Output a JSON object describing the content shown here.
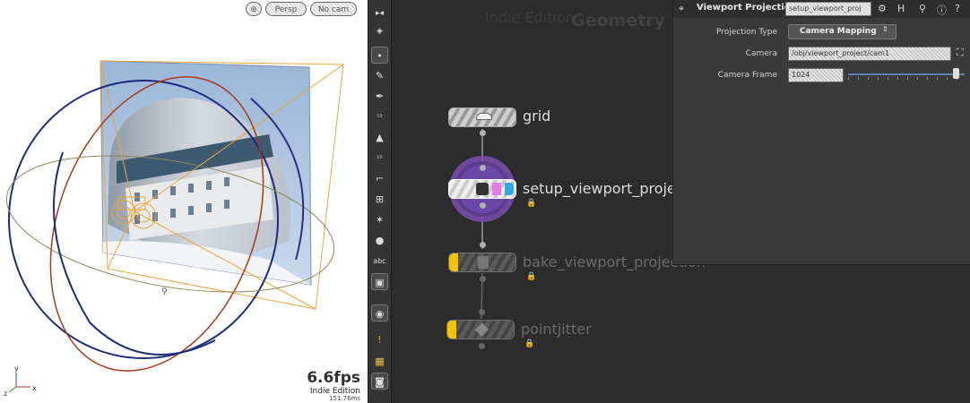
{
  "viewport": {
    "buttons": [
      "⊛",
      "Persp",
      "No cam"
    ],
    "fps": "6.6fps",
    "edition": "Indie Edition",
    "frame_time": "151.76ms",
    "axis_labels": [
      "y",
      "z",
      "x"
    ]
  },
  "toolbar": {
    "tools": [
      {
        "name": "select-tool-icon",
        "glyph": "•"
      },
      {
        "name": "brush-tool-icon",
        "glyph": "✎"
      },
      {
        "name": "pen-tool-icon",
        "glyph": "✒"
      },
      {
        "name": "number-tool-icon",
        "glyph": "¹²"
      },
      {
        "name": "paint-tool-icon",
        "glyph": "▲"
      },
      {
        "name": "number2-tool-icon",
        "glyph": "¹²"
      },
      {
        "name": "ruler-tool-icon",
        "glyph": "⌐"
      },
      {
        "name": "grid-tool-icon",
        "glyph": "⊞"
      },
      {
        "name": "snap-tool-icon",
        "glyph": "✶"
      },
      {
        "name": "sphere-tool-icon",
        "glyph": "●"
      },
      {
        "name": "text-tool-icon",
        "glyph": "abc"
      },
      {
        "name": "flipbook-tool-icon",
        "glyph": "▣"
      },
      {
        "name": "pin-tool-icon",
        "glyph": "◉"
      },
      {
        "name": "warning-tool-icon",
        "glyph": "!"
      },
      {
        "name": "layout-tool-icon",
        "glyph": "▦"
      },
      {
        "name": "capture-tool-icon",
        "glyph": "◙"
      }
    ]
  },
  "network": {
    "edition": "Indie Edition",
    "context": "Geometry",
    "nodes": [
      {
        "id": "grid",
        "label": "grid"
      },
      {
        "id": "setup",
        "label": "setup_viewport_project"
      },
      {
        "id": "bake",
        "label": "bake_viewport_projection"
      },
      {
        "id": "jitter",
        "label": "pointjitter"
      }
    ]
  },
  "params": {
    "title": "Viewport Projection",
    "node_name": "setup_viewport_proj",
    "projection_type_label": "Projection Type",
    "projection_type_value": "Camera Mapping",
    "camera_label": "Camera",
    "camera_value": "/obj/viewport_project/cam1",
    "frame_label": "Camera Frame",
    "frame_value": "1024"
  },
  "colors": {
    "viewport_bg": "#ffffff",
    "network_bg": "#2c2c2c",
    "selection_ring": "#7a4fb0",
    "flag_yellow": "#f5c400",
    "wire_orange": "#e8a73a",
    "wire_blue": "#2a2f8a",
    "wire_red": "#a63a1e"
  }
}
